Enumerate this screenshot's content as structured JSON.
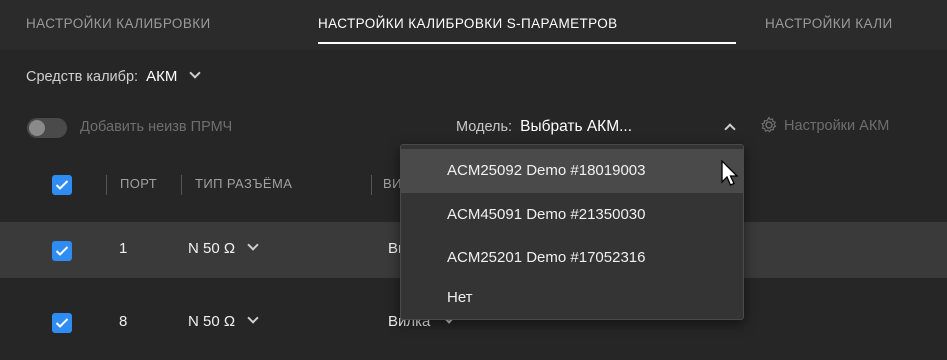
{
  "tabs": [
    {
      "label": "НАСТРОЙКИ КАЛИБРОВКИ"
    },
    {
      "label": "НАСТРОЙКИ КАЛИБРОВКИ S-ПАРАМЕТРОВ"
    },
    {
      "label": "НАСТРОЙКИ КАЛИ"
    }
  ],
  "calibration_source": {
    "label": "Средств калибр:",
    "value": "АКМ"
  },
  "toggle": {
    "label": "Добавить неизв ПРМЧ",
    "state": "off"
  },
  "model": {
    "label": "Модель:",
    "value": "Выбрать АКМ...",
    "settings_label": "Настройки АКМ"
  },
  "table": {
    "headers": [
      "ПОРТ",
      "ТИП РАЗЪЁМА",
      "ВИ"
    ],
    "rows": [
      {
        "port": "1",
        "connector_type": "N 50 Ω",
        "gender": "Вилка"
      },
      {
        "port": "8",
        "connector_type": "N 50 Ω",
        "gender": "Вилка"
      }
    ]
  },
  "model_dropdown": {
    "options": [
      "ACM25092 Demo #18019003",
      "ACM45091 Demo #21350030",
      "ACM25201 Demo #17052316",
      "Нет"
    ]
  },
  "colors": {
    "accent": "#2f8cf2",
    "background": "#262626",
    "selected_row": "#3a3a3a"
  }
}
